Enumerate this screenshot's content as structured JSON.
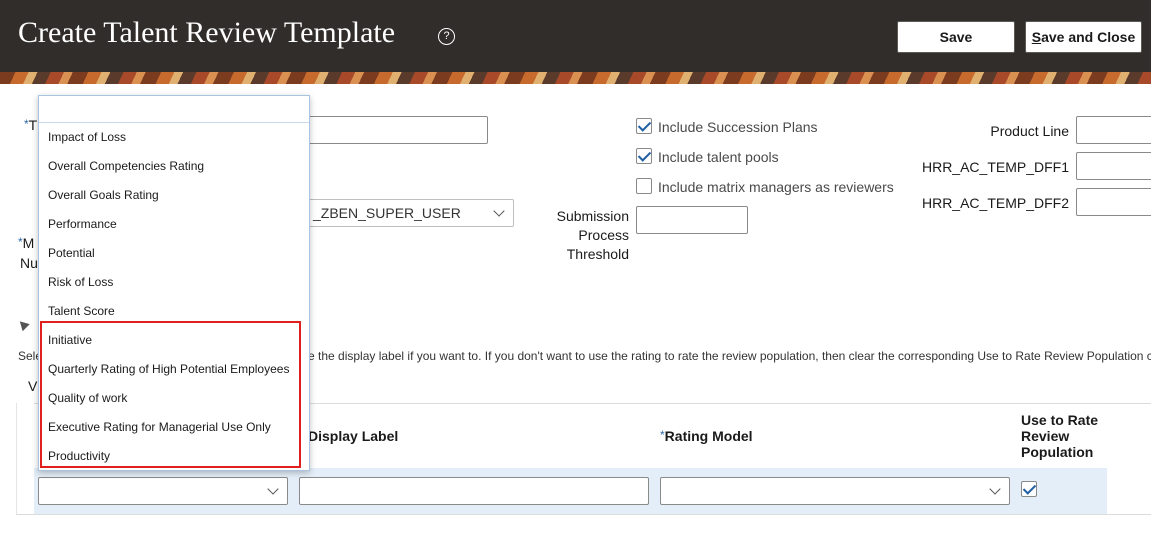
{
  "header": {
    "title": "Create Talent Review Template",
    "help_icon": "question-circle-icon",
    "save_label": "Save",
    "save_close_first": "S",
    "save_close_rest": "ave and Close"
  },
  "form": {
    "name_label_visible": "T",
    "mgr_label_line1": "M",
    "mgr_label_line2": "Nu",
    "role_value": "_ZBEN_SUPER_USER",
    "submission_label_1": "Submission",
    "submission_label_2": "Process",
    "submission_label_3": "Threshold",
    "product_line_label": "Product Line",
    "dff1_label": "HRR_AC_TEMP_DFF1",
    "dff2_label": "HRR_AC_TEMP_DFF2"
  },
  "options": {
    "succession": "Include Succession Plans",
    "talent_pools": "Include talent pools",
    "matrix_mgrs": "Include matrix managers as reviewers"
  },
  "dropdown": {
    "items": [
      "Impact of Loss",
      "Overall Competencies Rating",
      "Overall Goals Rating",
      "Performance",
      "Potential",
      "Risk of Loss",
      "Talent Score",
      "Initiative",
      "Quarterly Rating of High Potential Employees",
      "Quality of work",
      "Executive Rating for Managerial Use Only",
      "Productivity"
    ]
  },
  "section": {
    "instruction_left": "Sele",
    "instruction_right": "e the display label if you want to. If you don't want to use the rating to rate the review population, then clear the corresponding Use to Rate Review Population c",
    "view_label": "V"
  },
  "table": {
    "col_display_label": "Display Label",
    "col_rating_model": "Rating Model",
    "col_use_line1": "Use to Rate",
    "col_use_line2": "Review",
    "col_use_line3": "Population"
  },
  "colors": {
    "header_bg": "#312d2a",
    "highlight_border": "#e01f1f",
    "row_highlight": "#e4eef8"
  }
}
